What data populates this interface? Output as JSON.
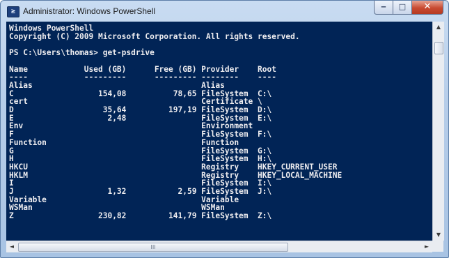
{
  "window": {
    "title": "Administrator: Windows PowerShell",
    "minimize_glyph": "‒",
    "maximize_glyph": "□",
    "close_glyph": "✕",
    "app_icon_glyph": "≥"
  },
  "console": {
    "banner_line1": "Windows PowerShell",
    "banner_line2": "Copyright (C) 2009 Microsoft Corporation. All rights reserved.",
    "prompt": "PS C:\\Users\\thomas> get-psdrive",
    "columns": [
      "Name",
      "Used (GB)",
      "Free (GB)",
      "Provider",
      "Root"
    ],
    "rows": [
      {
        "name": "Alias",
        "used": "",
        "free": "",
        "provider": "Alias",
        "root": ""
      },
      {
        "name": "C",
        "used": "154,08",
        "free": "78,65",
        "provider": "FileSystem",
        "root": "C:\\"
      },
      {
        "name": "cert",
        "used": "",
        "free": "",
        "provider": "Certificate",
        "root": "\\"
      },
      {
        "name": "D",
        "used": "35,64",
        "free": "197,19",
        "provider": "FileSystem",
        "root": "D:\\"
      },
      {
        "name": "E",
        "used": "2,48",
        "free": "",
        "provider": "FileSystem",
        "root": "E:\\"
      },
      {
        "name": "Env",
        "used": "",
        "free": "",
        "provider": "Environment",
        "root": ""
      },
      {
        "name": "F",
        "used": "",
        "free": "",
        "provider": "FileSystem",
        "root": "F:\\"
      },
      {
        "name": "Function",
        "used": "",
        "free": "",
        "provider": "Function",
        "root": ""
      },
      {
        "name": "G",
        "used": "",
        "free": "",
        "provider": "FileSystem",
        "root": "G:\\"
      },
      {
        "name": "H",
        "used": "",
        "free": "",
        "provider": "FileSystem",
        "root": "H:\\"
      },
      {
        "name": "HKCU",
        "used": "",
        "free": "",
        "provider": "Registry",
        "root": "HKEY_CURRENT_USER"
      },
      {
        "name": "HKLM",
        "used": "",
        "free": "",
        "provider": "Registry",
        "root": "HKEY_LOCAL_MACHINE"
      },
      {
        "name": "I",
        "used": "",
        "free": "",
        "provider": "FileSystem",
        "root": "I:\\"
      },
      {
        "name": "J",
        "used": "1,32",
        "free": "2,59",
        "provider": "FileSystem",
        "root": "J:\\"
      },
      {
        "name": "Variable",
        "used": "",
        "free": "",
        "provider": "Variable",
        "root": ""
      },
      {
        "name": "WSMan",
        "used": "",
        "free": "",
        "provider": "WSMan",
        "root": ""
      },
      {
        "name": "Z",
        "used": "230,82",
        "free": "141,79",
        "provider": "FileSystem",
        "root": "Z:\\"
      }
    ],
    "background_color": "#012456",
    "text_color": "#eeedf0"
  },
  "scrollbars": {
    "up_glyph": "▲",
    "down_glyph": "▼",
    "left_glyph": "◄",
    "right_glyph": "►",
    "thumb_grip": "III"
  }
}
